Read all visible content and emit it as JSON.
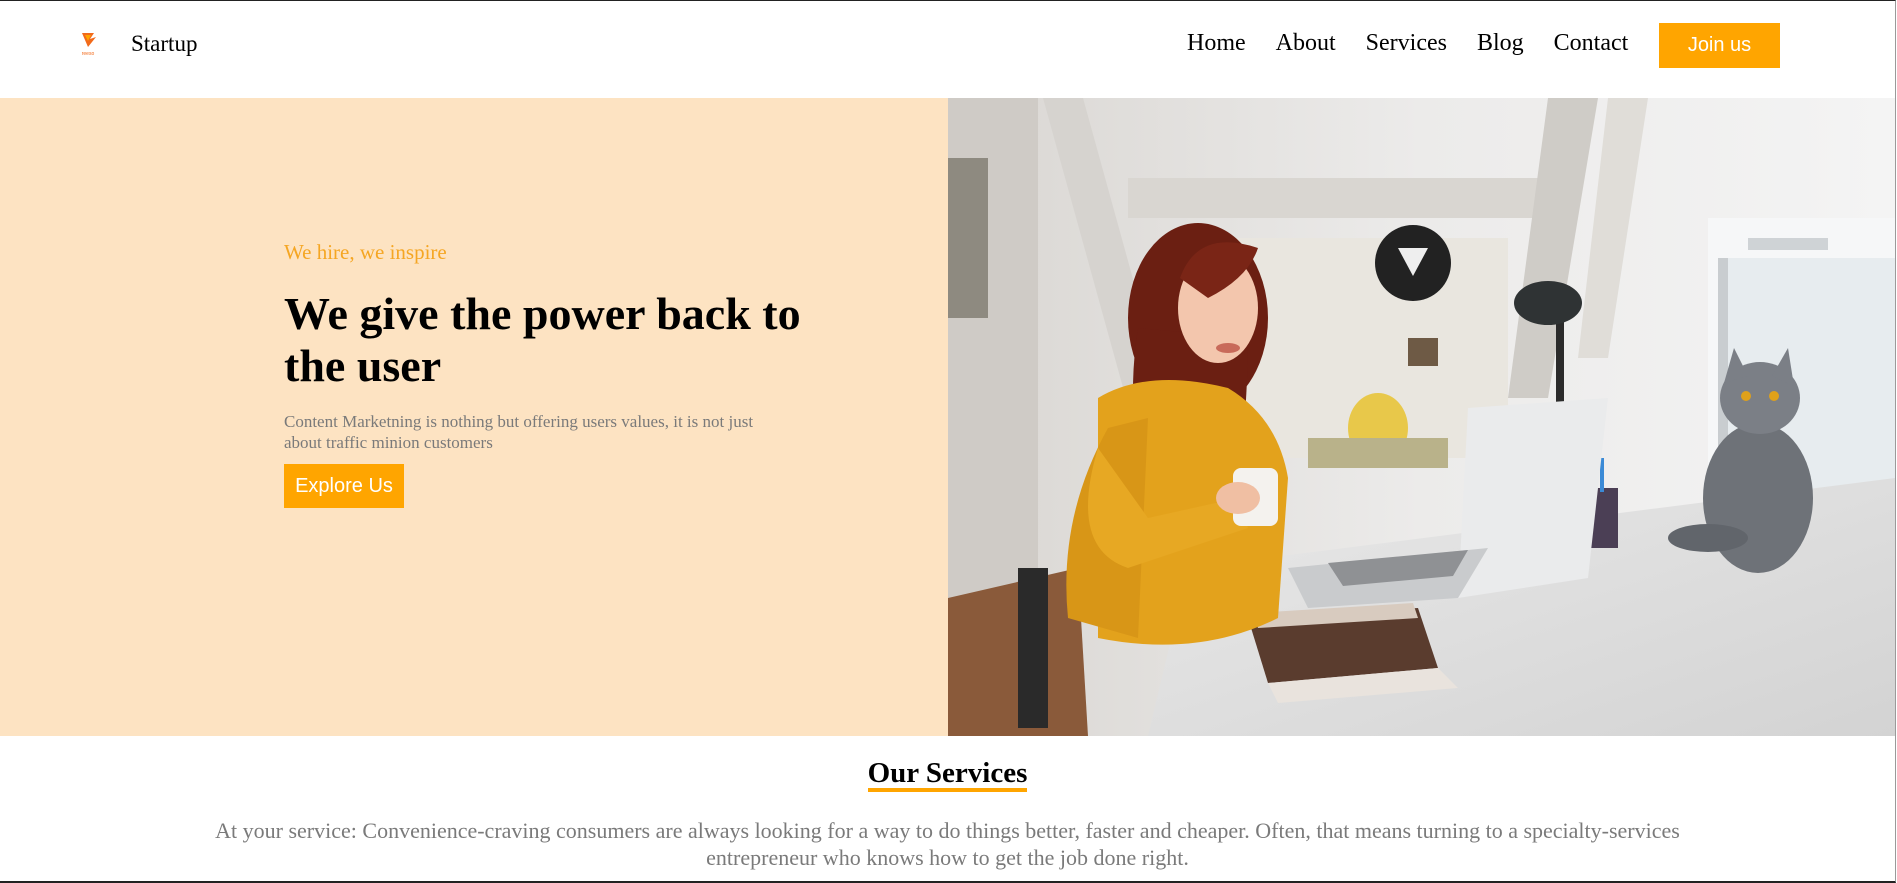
{
  "navbar": {
    "logo_icon": "fox-logo-icon",
    "logo_text": "reeso",
    "brand": "Startup",
    "links": [
      "Home",
      "About",
      "Services",
      "Blog",
      "Contact"
    ],
    "join_label": "Join us"
  },
  "hero": {
    "tagline": "We hire, we inspire",
    "headline": "We give the power back to the user",
    "description": "Content Marketning is nothing but offering users values, it is not just about traffic minion customers",
    "cta_label": "Explore Us",
    "image": "woman-with-laptop-and-cat-photo"
  },
  "services": {
    "title": "Our Services",
    "description": "At your service: Convenience-craving consumers are always looking for a way to do things better, faster and cheaper. Often, that means turning to a specialty-services entrepreneur who knows how to get the job done right."
  },
  "colors": {
    "accent": "#ffa500",
    "hero_bg": "#fde3c2",
    "muted_text": "#7a7a7a"
  }
}
